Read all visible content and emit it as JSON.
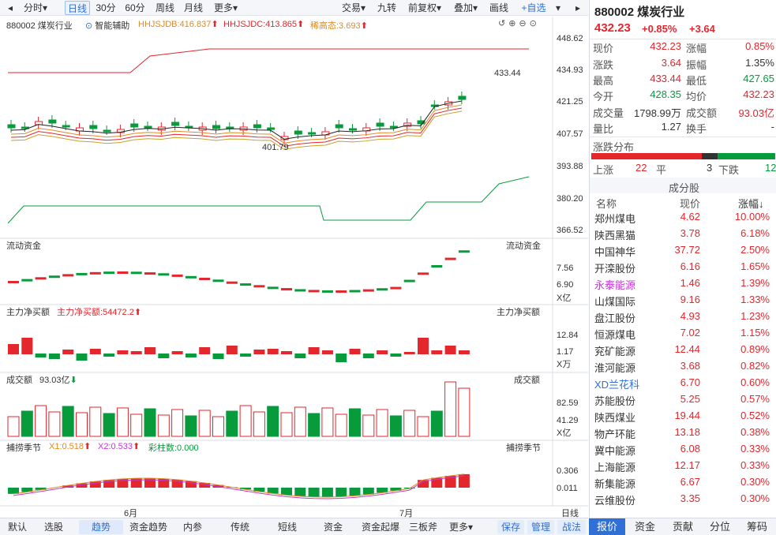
{
  "toolbar": {
    "left": [
      "分时",
      "日线",
      "30分",
      "60分",
      "周线",
      "月线",
      "更多"
    ],
    "right": [
      "交易",
      "九转",
      "前复权",
      "叠加",
      "画线",
      "自选"
    ],
    "active": "日线"
  },
  "main_chart": {
    "code_name": "880002 煤炭行业",
    "assist": "智能辅助",
    "hhjsjdb": "HHJSJDB:416.837",
    "hhjsjdc": "HHJSJDC:413.865",
    "xi_gao": "稀高态:3.693",
    "y_ticks": [
      "448.62",
      "434.93",
      "421.25",
      "407.57",
      "393.88",
      "380.20",
      "366.52"
    ],
    "high_label": "433.44",
    "low_label": "401.79"
  },
  "flow_pane": {
    "title": "流动资金",
    "title_right": "流动资金",
    "y_ticks": [
      "7.56",
      "6.90"
    ],
    "unit": "X亿"
  },
  "main_net_pane": {
    "title": "主力净买额",
    "value": "主力净买额:54472.2",
    "title_right": "主力净买额",
    "y_ticks": [
      "12.84",
      "1.17"
    ],
    "unit": "X万"
  },
  "volume_pane": {
    "title": "成交额",
    "value": "93.03亿",
    "title_right": "成交额",
    "y_ticks": [
      "82.59",
      "41.29"
    ],
    "unit": "X亿"
  },
  "season_pane": {
    "title": "捕捞季节",
    "x1": "X1:0.518",
    "x2": "X2:0.533",
    "bars": "彩柱数:0.000",
    "title_right": "捕捞季节",
    "y_ticks": [
      "0.306",
      "0.011"
    ]
  },
  "x_axis": {
    "jun": "6月",
    "jul": "7月",
    "right": "日线"
  },
  "bottom_tabs": [
    "默认",
    "选股",
    "趋势",
    "资金趋势",
    "内参",
    "传统",
    "短线",
    "资金",
    "资金起爆",
    "三板斧",
    "更多"
  ],
  "bottom_active": "趋势",
  "bottom_right": [
    "保存",
    "管理",
    "战法"
  ],
  "quote": {
    "code": "880002 煤炭行业",
    "price": "432.23",
    "pct": "+0.85%",
    "chg": "+3.64",
    "rows": [
      [
        "现价",
        "432.23",
        "涨幅",
        "0.85%"
      ],
      [
        "涨跌",
        "3.64",
        "振幅",
        "1.35%"
      ],
      [
        "最高",
        "433.44",
        "最低",
        "427.65"
      ],
      [
        "今开",
        "428.35",
        "均价",
        "432.23"
      ],
      [
        "成交量",
        "1798.99万",
        "成交额",
        "93.03亿"
      ],
      [
        "量比",
        "1.27",
        "换手",
        "-"
      ]
    ]
  },
  "distribution": {
    "title": "涨跌分布",
    "up_label": "上涨",
    "up": "22",
    "flat_label": "平",
    "flat": "3",
    "down_label": "下跌",
    "down": "12"
  },
  "components": {
    "title": "成分股",
    "headers": [
      "名称",
      "现价",
      "涨幅↓"
    ],
    "rows": [
      [
        "郑州煤电",
        "4.62",
        "10.00%"
      ],
      [
        "陕西黑猫",
        "3.78",
        "6.18%"
      ],
      [
        "中国神华",
        "37.72",
        "2.50%"
      ],
      [
        "开滦股份",
        "6.16",
        "1.65%"
      ],
      [
        "永泰能源",
        "1.46",
        "1.39%"
      ],
      [
        "山煤国际",
        "9.16",
        "1.33%"
      ],
      [
        "盘江股份",
        "4.93",
        "1.23%"
      ],
      [
        "恒源煤电",
        "7.02",
        "1.15%"
      ],
      [
        "兖矿能源",
        "12.44",
        "0.89%"
      ],
      [
        "淮河能源",
        "3.68",
        "0.82%"
      ],
      [
        "XD兰花科",
        "6.70",
        "0.60%"
      ],
      [
        "苏能股份",
        "5.25",
        "0.57%"
      ],
      [
        "陕西煤业",
        "19.44",
        "0.52%"
      ],
      [
        "物产环能",
        "13.18",
        "0.38%"
      ],
      [
        "冀中能源",
        "6.08",
        "0.33%"
      ],
      [
        "上海能源",
        "12.17",
        "0.33%"
      ],
      [
        "新集能源",
        "6.67",
        "0.30%"
      ],
      [
        "云维股份",
        "3.35",
        "0.30%"
      ]
    ]
  },
  "right_tabs": [
    "报价",
    "资金",
    "贡献",
    "分位",
    "筹码"
  ],
  "colors": {
    "up": "#e4262d",
    "down": "#089b3c",
    "accent": "#2f6fd6"
  }
}
